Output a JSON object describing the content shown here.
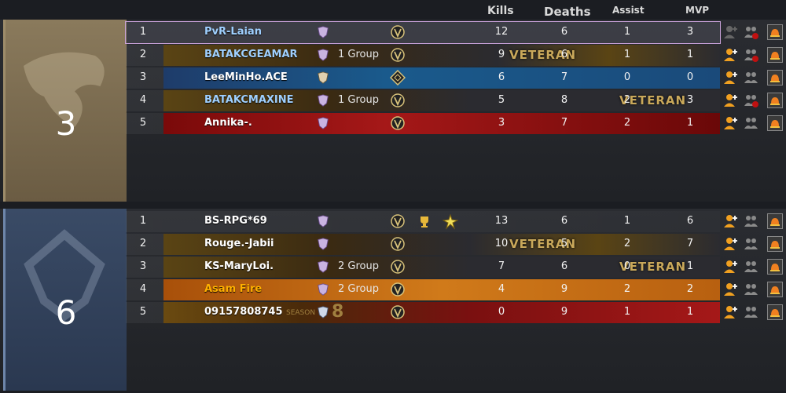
{
  "headers": {
    "kills": "Kills",
    "deaths": "Deaths",
    "assist": "Assist",
    "mvp": "MVP"
  },
  "teams": [
    {
      "player_count": "3",
      "color": "#8a7a5c",
      "players": [
        {
          "rank": "1",
          "name": "PvR-Laian",
          "group": "",
          "kills": "12",
          "deaths": "6",
          "assist": "1",
          "mvp": "3",
          "highlight": true
        },
        {
          "rank": "2",
          "name": "BATAKCGEAMAR",
          "group": "1 Group",
          "kills": "9",
          "deaths": "6",
          "assist": "1",
          "mvp": "1"
        },
        {
          "rank": "3",
          "name": "LeeMinHo.ACE",
          "group": "",
          "kills": "6",
          "deaths": "7",
          "assist": "0",
          "mvp": "0"
        },
        {
          "rank": "4",
          "name": "BATAKCMAXINE",
          "group": "1 Group",
          "kills": "5",
          "deaths": "8",
          "assist": "2",
          "mvp": "3"
        },
        {
          "rank": "5",
          "name": "Annika-.",
          "group": "",
          "kills": "3",
          "deaths": "7",
          "assist": "2",
          "mvp": "1"
        }
      ]
    },
    {
      "player_count": "6",
      "color": "#3a4b66",
      "players": [
        {
          "rank": "1",
          "name": "BS-RPG*69",
          "group": "",
          "kills": "13",
          "deaths": "6",
          "assist": "1",
          "mvp": "6"
        },
        {
          "rank": "2",
          "name": "Rouge.-Jabii",
          "group": "",
          "kills": "10",
          "deaths": "5",
          "assist": "2",
          "mvp": "7"
        },
        {
          "rank": "3",
          "name": "KS-MaryLoi.",
          "group": "2 Group",
          "kills": "7",
          "deaths": "6",
          "assist": "0",
          "mvp": "1"
        },
        {
          "rank": "4",
          "name": "Asam Fire",
          "group": "2 Group",
          "kills": "4",
          "deaths": "9",
          "assist": "2",
          "mvp": "2"
        },
        {
          "rank": "5",
          "name": "09157808745",
          "group": "",
          "kills": "0",
          "deaths": "9",
          "assist": "1",
          "mvp": "1"
        }
      ]
    }
  ],
  "decor": {
    "veteran": "VETERAN",
    "season": "SEASON",
    "season_num": "8"
  },
  "icons": {
    "add_friend": "add-friend-icon",
    "group": "group-icon",
    "report": "report-icon",
    "rank_badge": "rank-badge-icon",
    "veteran_badge": "veteran-badge-icon",
    "trophy": "trophy-icon",
    "star_burst": "star-burst-icon"
  }
}
